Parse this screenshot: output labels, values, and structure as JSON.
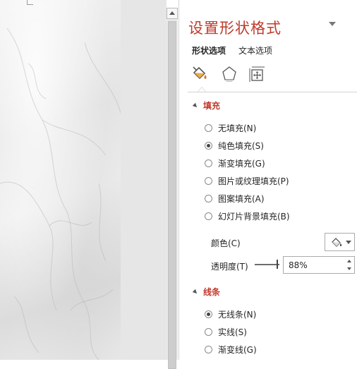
{
  "pane": {
    "title": "设置形状格式",
    "tabs": [
      {
        "label": "形状选项",
        "active": true
      },
      {
        "label": "文本选项",
        "active": false
      }
    ],
    "icons": [
      "fill-line-icon",
      "effects-icon",
      "size-properties-icon"
    ],
    "accent_color": "#c0392b"
  },
  "fill": {
    "heading": "填充",
    "options": [
      {
        "label": "无填充(N)",
        "checked": false
      },
      {
        "label": "纯色填充(S)",
        "checked": true
      },
      {
        "label": "渐变填充(G)",
        "checked": false
      },
      {
        "label": "图片或纹理填充(P)",
        "checked": false
      },
      {
        "label": "图案填充(A)",
        "checked": false
      },
      {
        "label": "幻灯片背景填充(B)",
        "checked": false
      }
    ],
    "color_label": "颜色(C)",
    "transparency_label": "透明度(T)",
    "transparency_value": "88%"
  },
  "line": {
    "heading": "线条",
    "options": [
      {
        "label": "无线条(N)",
        "checked": true
      },
      {
        "label": "实线(S)",
        "checked": false
      },
      {
        "label": "渐变线(G)",
        "checked": false
      }
    ]
  }
}
